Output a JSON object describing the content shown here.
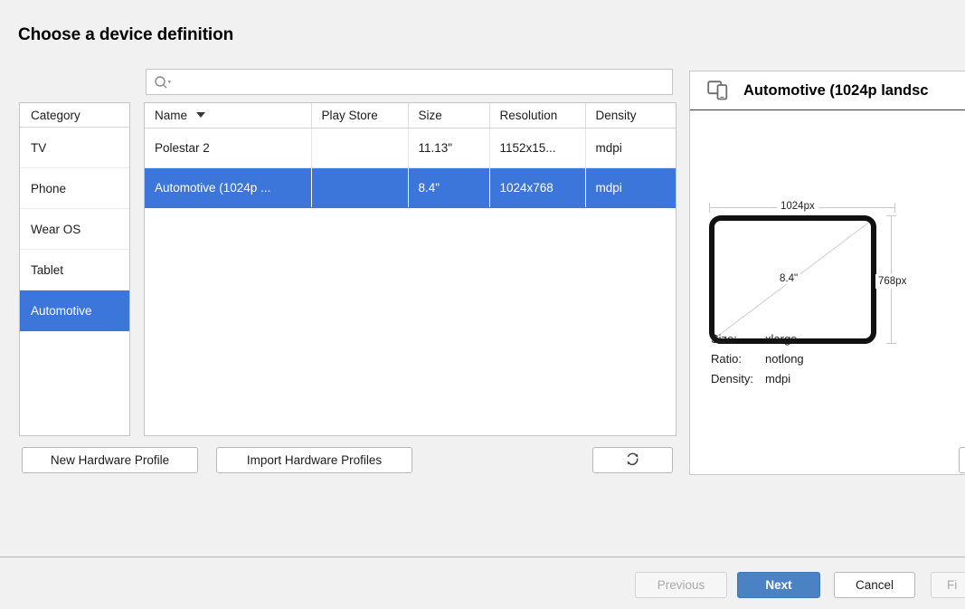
{
  "dialog": {
    "title": "Choose a device definition"
  },
  "search": {
    "placeholder": "",
    "value": "",
    "icon": "search-icon",
    "dropdown_icon": "chevron-down-icon"
  },
  "category_panel": {
    "header": "Category",
    "items": [
      {
        "label": "TV",
        "selected": false
      },
      {
        "label": "Phone",
        "selected": false
      },
      {
        "label": "Wear OS",
        "selected": false
      },
      {
        "label": "Tablet",
        "selected": false
      },
      {
        "label": "Automotive",
        "selected": true
      }
    ],
    "selected": "Automotive"
  },
  "device_table": {
    "columns": [
      "Name",
      "Play Store",
      "Size",
      "Resolution",
      "Density"
    ],
    "sort_column": "Name",
    "sort_direction": "descending",
    "rows": [
      {
        "name": "Polestar 2",
        "play_store": "",
        "size": "11.13\"",
        "resolution": "1152x15...",
        "density": "mdpi",
        "selected": false
      },
      {
        "name": "Automotive (1024p ...",
        "play_store": "",
        "size": "8.4\"",
        "resolution": "1024x768",
        "density": "mdpi",
        "selected": true
      }
    ]
  },
  "table_actions": {
    "new_hardware_profile": "New Hardware Profile",
    "import_hardware_profiles": "Import Hardware Profiles",
    "refresh_icon": "refresh-icon"
  },
  "preview": {
    "icon": "devices-icon",
    "title": "Automotive (1024p landsc",
    "diagram": {
      "width_label": "1024px",
      "height_label": "768px",
      "diagonal_label": "8.4\""
    },
    "specs": [
      {
        "key": "Size:",
        "value": "xlarge"
      },
      {
        "key": "Ratio:",
        "value": "notlong"
      },
      {
        "key": "Density:",
        "value": "mdpi"
      }
    ]
  },
  "footer": {
    "previous": "Previous",
    "next": "Next",
    "cancel": "Cancel",
    "finish": "Fi"
  },
  "colors": {
    "selection_blue": "#3d76db",
    "default_button_blue": "#4a82c4",
    "window_background": "#f1f1f1",
    "panel_background": "#ffffff",
    "disabled_text": "#a8a8a8"
  }
}
